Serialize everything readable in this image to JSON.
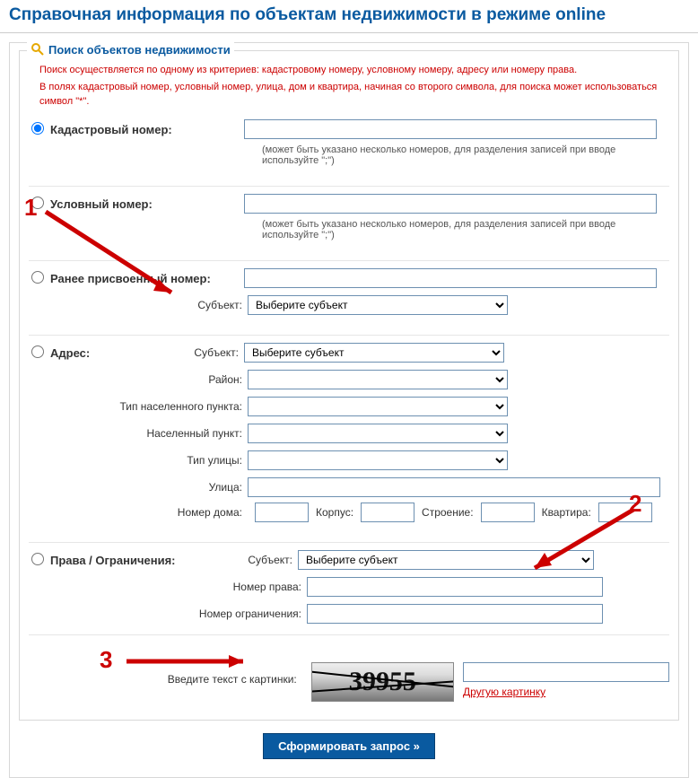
{
  "page": {
    "title": "Справочная информация по объектам недвижимости в режиме online"
  },
  "legend": "Поиск объектов недвижимости",
  "warnings": {
    "line1": "Поиск осуществляется по одному из критериев: кадастровому номеру, условному номеру, адресу или номеру права.",
    "line2": "В полях кадастровый номер, условный номер, улица, дом и квартира, начиная со второго символа, для поиска может использоваться символ \"*\"."
  },
  "criteria": {
    "cad": {
      "label": "Кадастровый номер:",
      "hint": "(может быть указано несколько номеров, для разделения записей при вводе используйте \";\")"
    },
    "cond": {
      "label": "Условный номер:",
      "hint": "(может быть указано несколько номеров, для разделения записей при вводе используйте \";\")"
    },
    "old": {
      "label": "Ранее присвоенный номер:",
      "subject_label": "Субъект:"
    },
    "addr": {
      "label": "Адрес:",
      "subject_label": "Субъект:",
      "rayon_label": "Район:",
      "type_np_label": "Тип населенного пункта:",
      "np_label": "Населенный пункт:",
      "type_street_label": "Тип улицы:",
      "street_label": "Улица:",
      "house_label": "Номер дома:",
      "korpus_label": "Корпус:",
      "stroenie_label": "Строение:",
      "flat_label": "Квартира:"
    },
    "rights": {
      "label": "Права / Ограничения:",
      "subject_label": "Субъект:",
      "right_num_label": "Номер права:",
      "restr_num_label": "Номер ограничения:"
    }
  },
  "selects": {
    "subject_placeholder": "Выберите субъект"
  },
  "captcha": {
    "label": "Введите текст с картинки:",
    "digits": "39955",
    "another": "Другую картинку"
  },
  "submit": {
    "label": "Сформировать запрос »"
  },
  "annotations": {
    "n1": "1",
    "n2": "2",
    "n3": "3"
  }
}
